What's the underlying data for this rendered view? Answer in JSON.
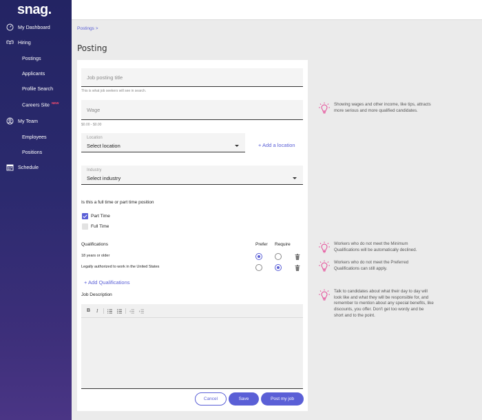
{
  "brand": {
    "logo": "snag.",
    "accent": "#5a5fd6"
  },
  "sidebar": {
    "items": [
      {
        "label": "My Dashboard",
        "icon": "gauge-icon"
      },
      {
        "label": "Hiring",
        "icon": "handshake-icon"
      },
      {
        "label": "Postings"
      },
      {
        "label": "Applicants"
      },
      {
        "label": "Profile Search"
      },
      {
        "label": "Careers Site",
        "badge": "NEW"
      },
      {
        "label": "My Team",
        "icon": "user-circle-icon"
      },
      {
        "label": "Employees"
      },
      {
        "label": "Positions"
      },
      {
        "label": "Schedule",
        "icon": "calendar-icon"
      }
    ]
  },
  "breadcrumb": "Postings >",
  "page_title": "Posting",
  "form": {
    "title_placeholder": "Job posting title",
    "title_hint": "This is what job seekers will see in search.",
    "wage_placeholder": "Wage",
    "wage_hint": "$0.00 - $0.00",
    "location_label": "Location",
    "location_value": "Select location",
    "add_location": "+ Add a location",
    "industry_label": "Industry",
    "industry_value": "Select industry",
    "employment_question": "Is this a full time or part time position",
    "options": [
      {
        "label": "Part Time",
        "checked": true
      },
      {
        "label": "Full Time",
        "checked": false
      }
    ],
    "qualifications": {
      "header": "Qualifications",
      "col_prefer": "Prefer",
      "col_require": "Require",
      "rows": [
        {
          "text": "18 years or older",
          "selected": "prefer"
        },
        {
          "text": "Legally authorized to work in the United States",
          "selected": "require"
        }
      ],
      "add_label": "+ Add Qualifications"
    },
    "job_description_label": "Job Description",
    "toolbar": {
      "bold": "B",
      "italic": "I"
    }
  },
  "actions": {
    "cancel": "Cancel",
    "save": "Save",
    "post": "Post my job"
  },
  "tips": [
    "Showing wages and other income, like tips, attracts more serious and more qualified candidates.",
    "Workers who do not meet the Minimum Qualifications will be automatically declined.",
    "Workers who do not meet the Preferred Qualifications can still apply.",
    "Talk to candidates about what their day to day will look like and what they will be responsible for, and remember to mention about any special benefits, like discounts, you offer. Don't get too wordy and be short and to the point."
  ]
}
